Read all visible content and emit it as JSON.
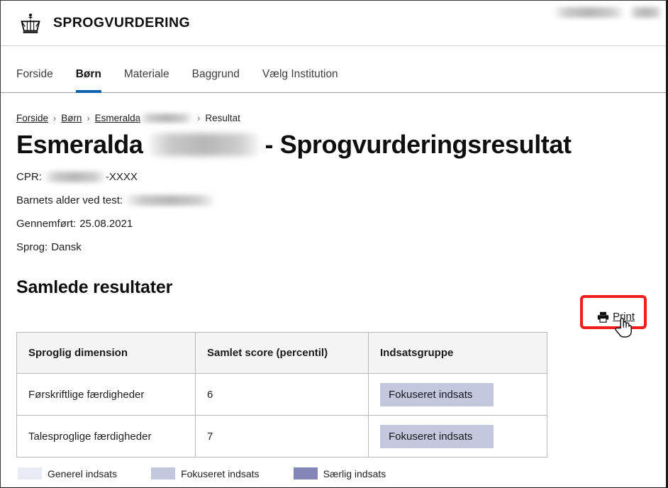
{
  "header": {
    "brand_title": "SPROGVURDERING",
    "logo_icon": "crown-icon",
    "user_name_redacted": true,
    "logout_redacted": true
  },
  "nav": {
    "items": [
      {
        "label": "Forside",
        "active": false
      },
      {
        "label": "Børn",
        "active": true
      },
      {
        "label": "Materiale",
        "active": false
      },
      {
        "label": "Baggrund",
        "active": false
      },
      {
        "label": "Vælg Institution",
        "active": false
      }
    ]
  },
  "breadcrumb": {
    "items": [
      {
        "label": "Forside",
        "link": true
      },
      {
        "label": "Børn",
        "link": true
      },
      {
        "label": "Esmeralda",
        "link": true,
        "redacted_suffix": true
      },
      {
        "label": "Resultat",
        "link": false
      }
    ],
    "separator": "›"
  },
  "page": {
    "title_first_name": "Esmeralda",
    "title_suffix": "- Sprogvurderingsresultat",
    "meta": {
      "cpr_label": "CPR:",
      "cpr_visible_tail": "-XXXX",
      "age_label": "Barnets alder ved test:",
      "completed_label": "Gennemført:",
      "completed_value": "25.08.2021",
      "language_label": "Sprog:",
      "language_value": "Dansk"
    }
  },
  "results_section": {
    "heading": "Samlede resultater",
    "print": {
      "label": "Print",
      "icon": "printer-icon",
      "highlighted": true,
      "cursor": "pointer-hand-cursor"
    },
    "table": {
      "columns": [
        "Sproglig dimension",
        "Samlet score (percentil)",
        "Indsatsgruppe"
      ],
      "rows": [
        {
          "dimension": "Førskriftlige færdigheder",
          "score": "6",
          "group": "Fokuseret indsats"
        },
        {
          "dimension": "Talesproglige færdigheder",
          "score": "7",
          "group": "Fokuseret indsats"
        }
      ]
    },
    "legend": [
      {
        "label": "Generel indsats",
        "color": "#e8eaf4"
      },
      {
        "label": "Fokuseret indsats",
        "color": "#c3c8de"
      },
      {
        "label": "Særlig indsats",
        "color": "#8287b8"
      }
    ]
  },
  "colors": {
    "accent_blue": "#1061ad",
    "highlight_red": "#f41d1d",
    "badge_bg": "#c3c8de",
    "table_header_bg": "#f4f4f4",
    "table_border": "#b8b8b8"
  }
}
